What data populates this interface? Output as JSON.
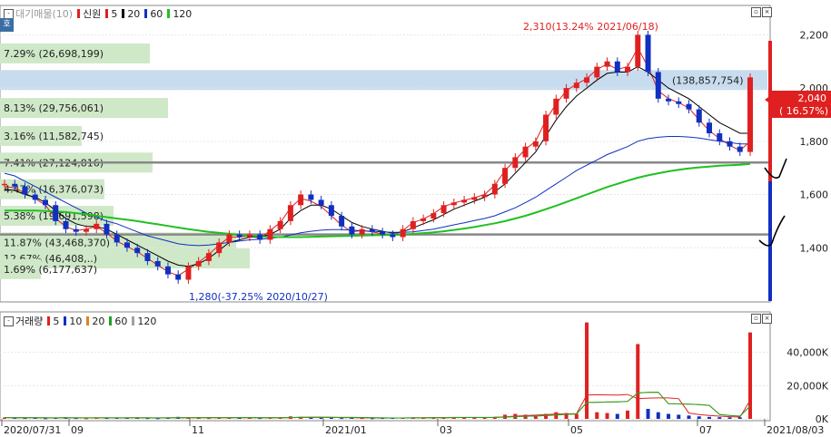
{
  "price_legend": {
    "title": "대기매물(10)",
    "items": [
      {
        "label": "신원",
        "color": "#e02020"
      },
      {
        "label": "5",
        "color": "#e02020"
      },
      {
        "label": "20",
        "color": "#000000"
      },
      {
        "label": "60",
        "color": "#1030c0"
      },
      {
        "label": "120",
        "color": "#20c020"
      }
    ]
  },
  "volume_legend": {
    "title": "거래량",
    "items": [
      {
        "label": "5",
        "color": "#e02020"
      },
      {
        "label": "10",
        "color": "#1030c0"
      },
      {
        "label": "20",
        "color": "#e08020"
      },
      {
        "label": "60",
        "color": "#20a020"
      },
      {
        "label": "120",
        "color": "#a0a0a0"
      }
    ]
  },
  "side_button": "호",
  "chart_data": [
    {
      "type": "candlestick",
      "ylim": [
        1200,
        2300
      ],
      "y_ticks": [
        "1,400",
        "1,600",
        "1,800",
        "2,000",
        "2,200"
      ],
      "x_tick_labels": [
        "2020/07/31",
        "09",
        "11",
        "2021/01",
        "03",
        "05",
        "07",
        "2021/08/03"
      ],
      "current_price": {
        "label": "2,040",
        "change": "( 16.57%)",
        "color": "#e02020"
      },
      "high_annotation": "2,310(13.24% 2021/06/18)",
      "low_annotation": "1,280(-37.25% 2020/10/27)",
      "volume_profile": [
        {
          "label": "7.29% (26,698,199)",
          "price": 2130,
          "width": 165
        },
        {
          "label": "(138,857,754)",
          "price": 2030,
          "width": 845,
          "highlight": true
        },
        {
          "label": "8.13% (29,756,061)",
          "price": 1925,
          "width": 185
        },
        {
          "label": "3.16% (11,582,745)",
          "price": 1820,
          "width": 90
        },
        {
          "label": "7.41% (27,124,816)",
          "price": 1720,
          "width": 168
        },
        {
          "label": "4.47% (16,376,073)",
          "price": 1620,
          "width": 115
        },
        {
          "label": "5.38% (19,691,598)",
          "price": 1520,
          "width": 125
        },
        {
          "label": "11.87% (43,468,370)",
          "price": 1420,
          "width": 260
        },
        {
          "label": "12.67% (46,408,..)",
          "price": 1360,
          "width": 275
        },
        {
          "label": "1.69% (6,177,637)",
          "price": 1320,
          "width": 45
        }
      ],
      "horizontal_lines": [
        1720,
        1450
      ],
      "series": [
        {
          "name": "신원",
          "values": [
            1640,
            1630,
            1600,
            1580,
            1560,
            1500,
            1470,
            1460,
            1470,
            1490,
            1450,
            1420,
            1400,
            1380,
            1350,
            1330,
            1300,
            1280,
            1330,
            1350,
            1380,
            1420,
            1450,
            1440,
            1450,
            1430,
            1470,
            1500,
            1560,
            1600,
            1580,
            1560,
            1520,
            1480,
            1450,
            1470,
            1460,
            1450,
            1440,
            1470,
            1500,
            1510,
            1530,
            1560,
            1570,
            1580,
            1590,
            1600,
            1640,
            1700,
            1740,
            1780,
            1800,
            1900,
            1960,
            2000,
            2020,
            2040,
            2080,
            2100,
            2060,
            2080,
            2200,
            2060,
            1960,
            1950,
            1940,
            1920,
            1870,
            1830,
            1800,
            1780,
            1760,
            2040
          ]
        },
        {
          "name": "5",
          "values": [
            1630,
            1625,
            1605,
            1585,
            1560,
            1510,
            1480,
            1465,
            1470,
            1480,
            1455,
            1425,
            1405,
            1385,
            1360,
            1335,
            1310,
            1295,
            1320,
            1345,
            1375,
            1410,
            1440,
            1440,
            1445,
            1435,
            1465,
            1495,
            1550,
            1585,
            1575,
            1555,
            1520,
            1485,
            1460,
            1465,
            1460,
            1452,
            1445,
            1465,
            1495,
            1508,
            1528,
            1555,
            1568,
            1578,
            1588,
            1600,
            1635,
            1690,
            1730,
            1770,
            1800,
            1880,
            1940,
            1990,
            2015,
            2035,
            2070,
            2090,
            2070,
            2080,
            2150,
            2080,
            1990,
            1960,
            1945,
            1925,
            1880,
            1840,
            1810,
            1785,
            1765,
            1800
          ]
        },
        {
          "name": "20",
          "values": [
            1620,
            1615,
            1600,
            1590,
            1570,
            1540,
            1510,
            1490,
            1480,
            1480,
            1470,
            1450,
            1430,
            1410,
            1390,
            1370,
            1350,
            1335,
            1330,
            1340,
            1360,
            1390,
            1420,
            1430,
            1440,
            1440,
            1450,
            1470,
            1510,
            1540,
            1560,
            1560,
            1545,
            1520,
            1495,
            1480,
            1470,
            1462,
            1455,
            1460,
            1475,
            1490,
            1505,
            1525,
            1545,
            1560,
            1575,
            1590,
            1610,
            1640,
            1680,
            1720,
            1760,
            1820,
            1880,
            1930,
            1970,
            2000,
            2030,
            2055,
            2060,
            2060,
            2080,
            2060,
            2030,
            2000,
            1980,
            1960,
            1930,
            1900,
            1870,
            1850,
            1830,
            1830
          ]
        },
        {
          "name": "60",
          "values": [
            1680,
            1670,
            1650,
            1630,
            1610,
            1590,
            1570,
            1550,
            1530,
            1515,
            1500,
            1490,
            1475,
            1460,
            1445,
            1435,
            1425,
            1415,
            1410,
            1408,
            1410,
            1415,
            1420,
            1425,
            1430,
            1432,
            1435,
            1440,
            1448,
            1456,
            1462,
            1466,
            1468,
            1468,
            1466,
            1464,
            1462,
            1460,
            1458,
            1458,
            1460,
            1465,
            1470,
            1478,
            1486,
            1494,
            1502,
            1510,
            1520,
            1535,
            1550,
            1570,
            1590,
            1615,
            1640,
            1665,
            1690,
            1710,
            1730,
            1750,
            1765,
            1780,
            1800,
            1810,
            1815,
            1818,
            1818,
            1816,
            1812,
            1806,
            1800,
            1795,
            1790,
            1790
          ]
        },
        {
          "name": "120",
          "values": [
            1540,
            1540,
            1540,
            1540,
            1538,
            1536,
            1534,
            1530,
            1526,
            1520,
            1515,
            1510,
            1505,
            1500,
            1494,
            1488,
            1482,
            1476,
            1470,
            1465,
            1460,
            1456,
            1452,
            1448,
            1445,
            1442,
            1440,
            1440,
            1440,
            1440,
            1441,
            1442,
            1443,
            1444,
            1445,
            1446,
            1447,
            1448,
            1449,
            1450,
            1452,
            1455,
            1458,
            1462,
            1467,
            1472,
            1478,
            1485,
            1492,
            1500,
            1510,
            1520,
            1532,
            1545,
            1558,
            1572,
            1586,
            1600,
            1614,
            1628,
            1640,
            1652,
            1663,
            1672,
            1680,
            1687,
            1693,
            1698,
            1702,
            1705,
            1708,
            1710,
            1712,
            1715
          ]
        }
      ]
    },
    {
      "type": "bar",
      "ylim": [
        0,
        60000
      ],
      "y_ticks": [
        "0K",
        "20,000K",
        "40,000K"
      ],
      "series": [
        {
          "name": "거래량",
          "values": [
            800,
            600,
            500,
            700,
            400,
            600,
            900,
            500,
            400,
            600,
            500,
            700,
            800,
            600,
            500,
            400,
            600,
            1200,
            900,
            700,
            500,
            600,
            800,
            700,
            600,
            500,
            700,
            900,
            1500,
            1200,
            900,
            700,
            600,
            500,
            600,
            500,
            400,
            500,
            600,
            700,
            900,
            800,
            700,
            900,
            1000,
            900,
            800,
            700,
            1200,
            2500,
            3000,
            2500,
            2000,
            3000,
            4000,
            3500,
            3000,
            58000,
            4000,
            3500,
            3000,
            5000,
            45000,
            6000,
            4000,
            3000,
            2500,
            2000,
            1500,
            1200,
            1000,
            900,
            900,
            52000
          ]
        }
      ]
    }
  ]
}
